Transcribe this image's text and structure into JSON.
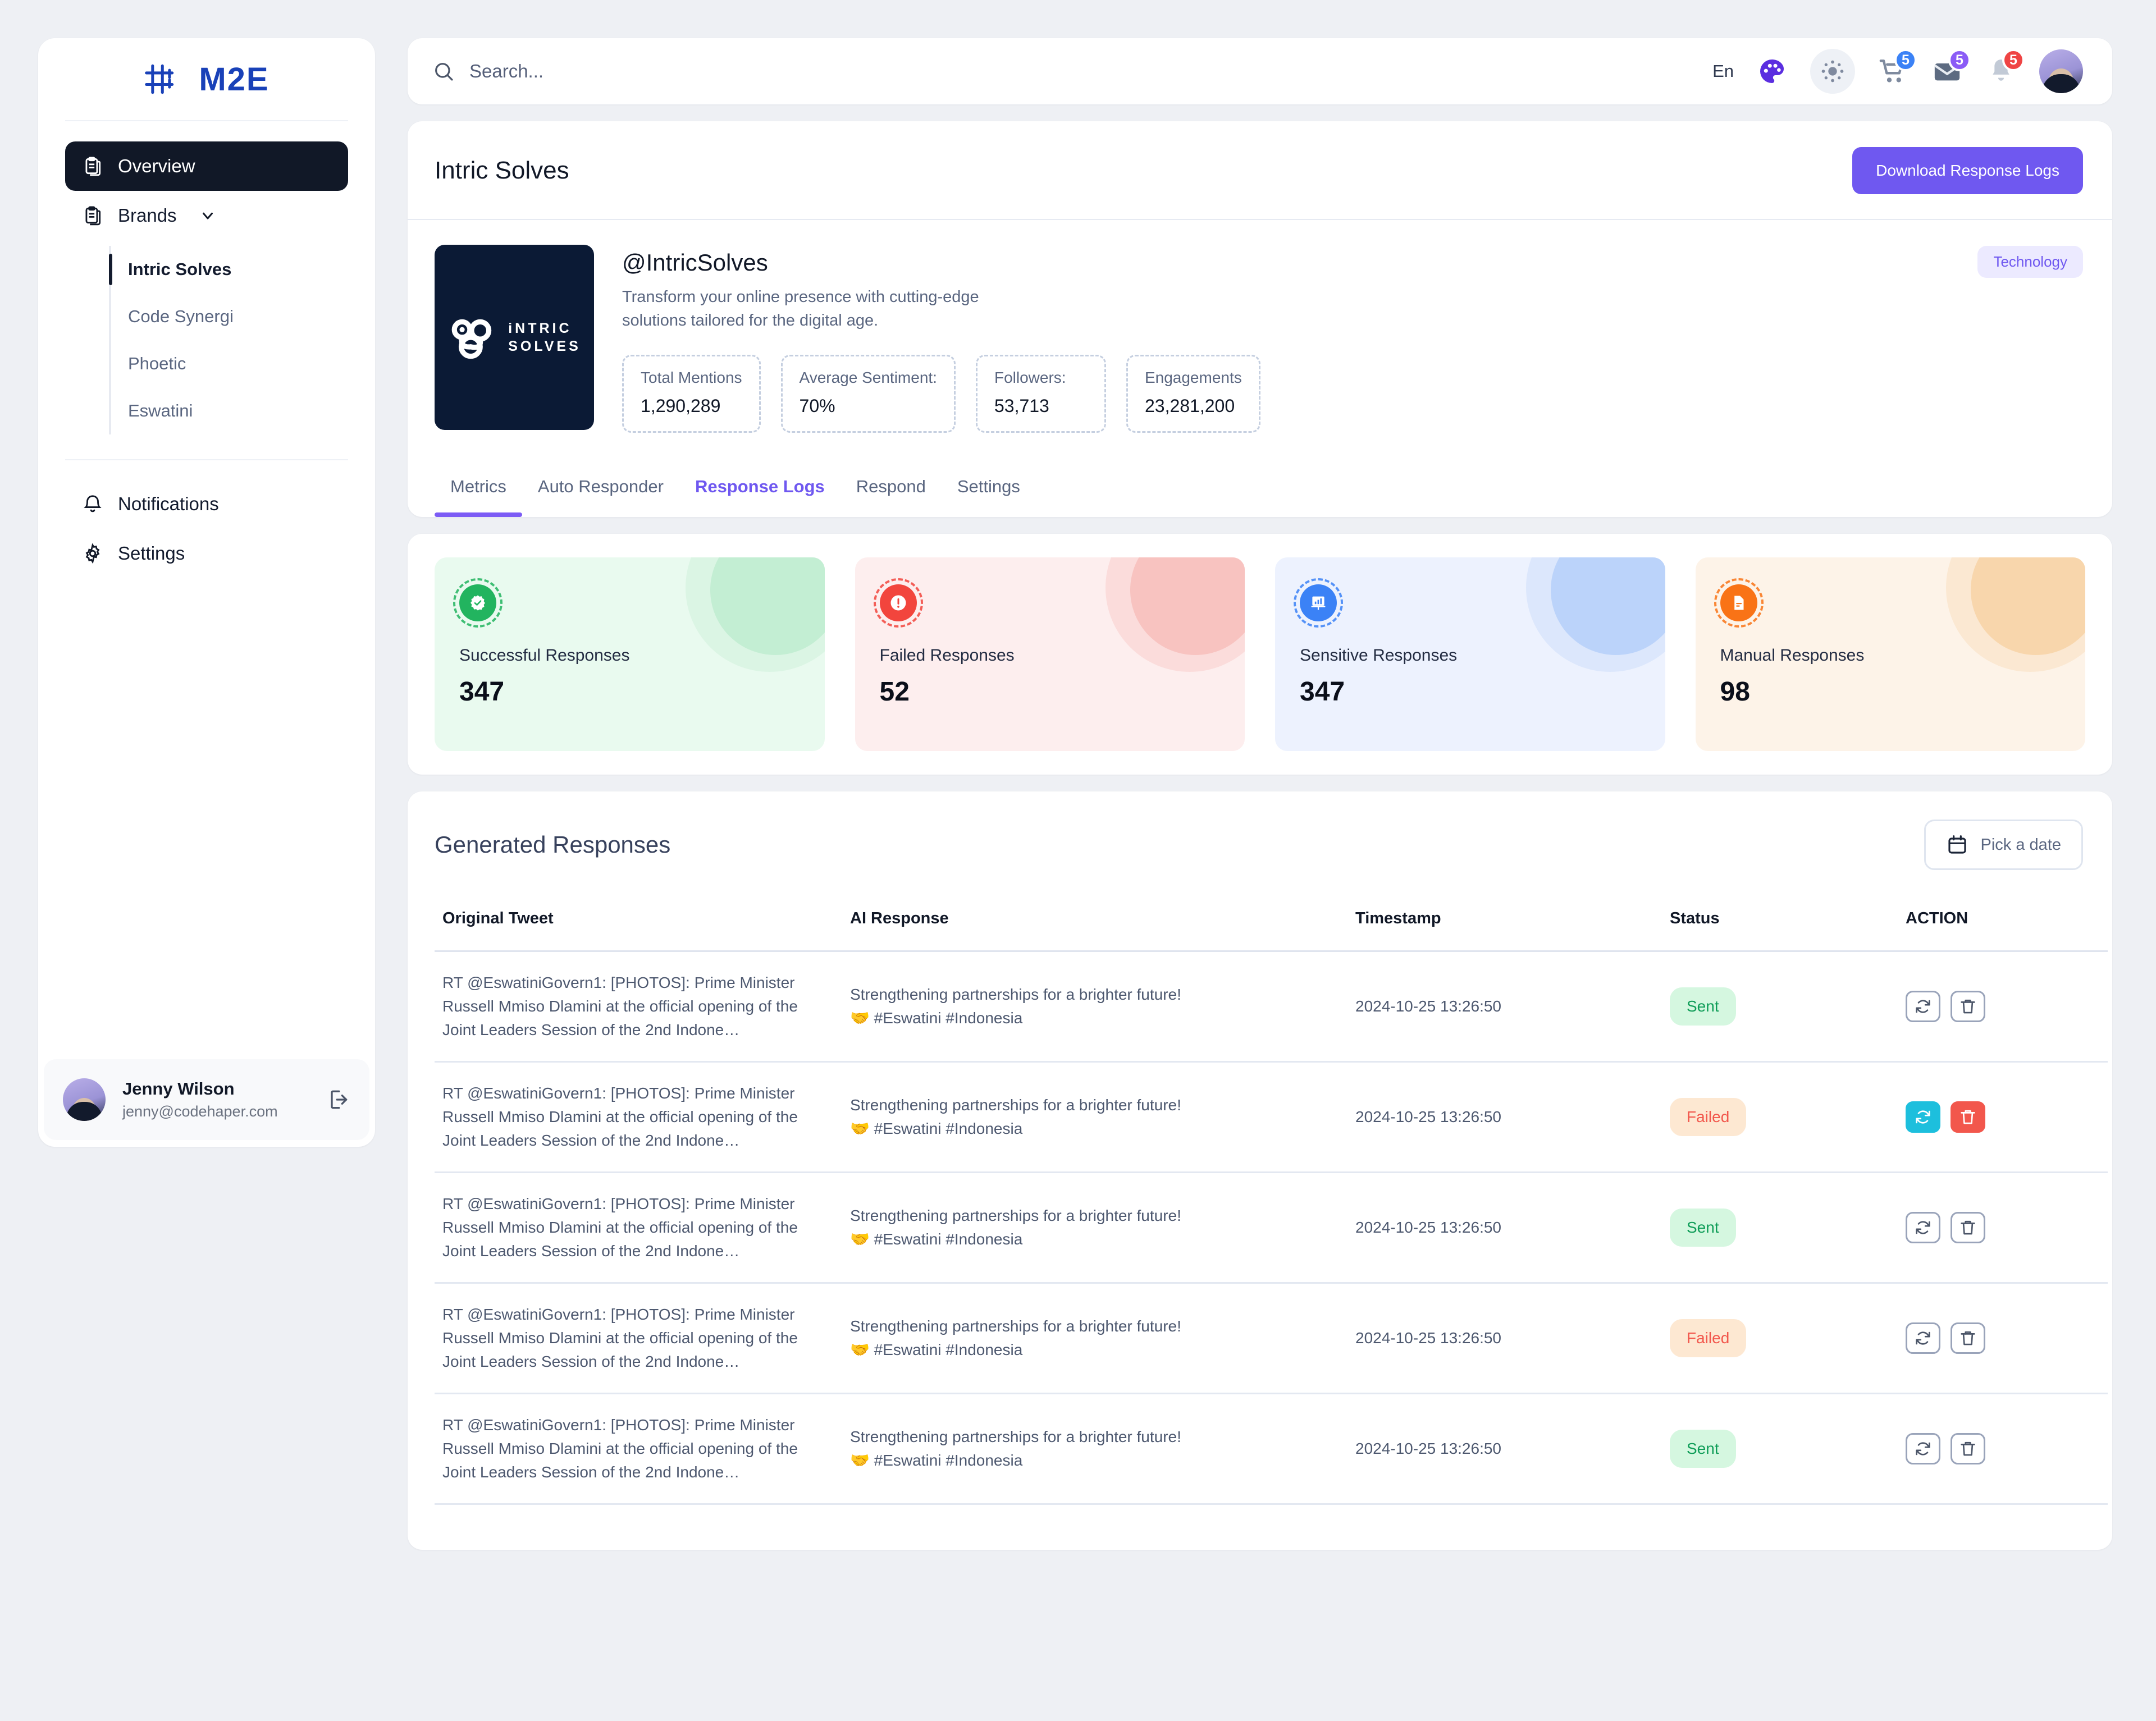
{
  "brand": {
    "logo_text": "M2E",
    "accent": "#1941b8"
  },
  "sidebar": {
    "nav": [
      {
        "label": "Overview",
        "icon": "clipboard-icon",
        "active": true
      },
      {
        "label": "Brands",
        "icon": "clipboard-icon",
        "active": false
      }
    ],
    "brands": [
      {
        "label": "Intric Solves",
        "selected": true
      },
      {
        "label": "Code Synergi",
        "selected": false
      },
      {
        "label": "Phoetic",
        "selected": false
      },
      {
        "label": "Eswatini",
        "selected": false
      }
    ],
    "lower": [
      {
        "label": "Notifications",
        "icon": "bell-icon"
      },
      {
        "label": "Settings",
        "icon": "gear-icon"
      }
    ],
    "profile": {
      "name": "Jenny Wilson",
      "email": "jenny@codehaper.com"
    }
  },
  "topbar": {
    "search_placeholder": "Search...",
    "search_value": "",
    "language": "En",
    "icons": [
      {
        "name": "palette-icon",
        "badge": null
      },
      {
        "name": "sun-icon",
        "badge": null
      },
      {
        "name": "cart-icon",
        "badge": "5",
        "badge_color": "#3b82f6"
      },
      {
        "name": "mail-icon",
        "badge": "5",
        "badge_color": "#8b5cf6"
      },
      {
        "name": "bell-icon",
        "badge": "5",
        "badge_color": "#ef4444"
      }
    ]
  },
  "brand_panel": {
    "title": "Intric Solves",
    "download_button": "Download Response Logs",
    "logo_line1": "iNTRIC",
    "logo_line2": "SOLVES",
    "handle": "@IntricSolves",
    "bio": "Transform your online presence with cutting-edge solutions tailored for the digital age.",
    "category_tag": "Technology",
    "stats": [
      {
        "label": "Total Mentions",
        "value": "1,290,289"
      },
      {
        "label": "Average Sentiment:",
        "value": "70%"
      },
      {
        "label": "Followers:",
        "value": "53,713"
      },
      {
        "label": "Engagements",
        "value": "23,281,200"
      }
    ]
  },
  "tabs": [
    {
      "label": "Metrics",
      "underlined": true,
      "current": false
    },
    {
      "label": "Auto Responder",
      "underlined": false,
      "current": false
    },
    {
      "label": "Response Logs",
      "underlined": false,
      "current": true
    },
    {
      "label": "Respond",
      "underlined": false,
      "current": false
    },
    {
      "label": "Settings",
      "underlined": false,
      "current": false
    }
  ],
  "stat_cards": [
    {
      "label": "Successful Responses",
      "value": "347",
      "icon": "check-badge-icon",
      "bg": "#e9faef",
      "blob_a": "#dbf5e4",
      "blob_b": "#c3eed3",
      "accent": "#22b45f"
    },
    {
      "label": "Failed Responses",
      "value": "52",
      "icon": "alert-circle-icon",
      "bg": "#fdeeee",
      "blob_a": "#fbdcdb",
      "blob_b": "#f8c3c0",
      "accent": "#f2453d"
    },
    {
      "label": "Sensitive Responses",
      "value": "347",
      "icon": "presentation-chart-icon",
      "bg": "#edf2fe",
      "blob_a": "#dce7fc",
      "blob_b": "#bbd3fa",
      "accent": "#3b82f6"
    },
    {
      "label": "Manual Responses",
      "value": "98",
      "icon": "document-icon",
      "bg": "#fdf3e8",
      "blob_a": "#fbe8d2",
      "blob_b": "#f8d6ac",
      "accent": "#f97316"
    }
  ],
  "table": {
    "title": "Generated Responses",
    "date_button": "Pick a date",
    "columns": [
      "Original Tweet",
      "AI Response",
      "Timestamp",
      "Status",
      "ACTION"
    ],
    "rows": [
      {
        "tweet": "RT @EswatiniGovern1: [PHOTOS]: Prime Minister Russell Mmiso Dlamini at the official opening of the Joint Leaders Session of the 2nd Indone…",
        "response_line1": "Strengthening partnerships for a brighter future!",
        "response_emoji": "🤝",
        "response_line2": "#Eswatini #Indonesia",
        "timestamp": "2024-10-25 13:26:50",
        "status": "Sent",
        "status_type": "sent",
        "actions_highlighted": false
      },
      {
        "tweet": "RT @EswatiniGovern1: [PHOTOS]: Prime Minister Russell Mmiso Dlamini at the official opening of the Joint Leaders Session of the 2nd Indone…",
        "response_line1": "Strengthening partnerships for a brighter future!",
        "response_emoji": "🤝",
        "response_line2": "#Eswatini #Indonesia",
        "timestamp": "2024-10-25 13:26:50",
        "status": "Failed",
        "status_type": "failed",
        "actions_highlighted": true
      },
      {
        "tweet": "RT @EswatiniGovern1: [PHOTOS]: Prime Minister Russell Mmiso Dlamini at the official opening of the Joint Leaders Session of the 2nd Indone…",
        "response_line1": "Strengthening partnerships for a brighter future!",
        "response_emoji": "🤝",
        "response_line2": "#Eswatini #Indonesia",
        "timestamp": "2024-10-25 13:26:50",
        "status": "Sent",
        "status_type": "sent",
        "actions_highlighted": false
      },
      {
        "tweet": "RT @EswatiniGovern1: [PHOTOS]: Prime Minister Russell Mmiso Dlamini at the official opening of the Joint Leaders Session of the 2nd Indone…",
        "response_line1": "Strengthening partnerships for a brighter future!",
        "response_emoji": "🤝",
        "response_line2": "#Eswatini #Indonesia",
        "timestamp": "2024-10-25 13:26:50",
        "status": "Failed",
        "status_type": "failed",
        "actions_highlighted": false
      },
      {
        "tweet": "RT @EswatiniGovern1: [PHOTOS]: Prime Minister Russell Mmiso Dlamini at the official opening of the Joint Leaders Session of the 2nd Indone…",
        "response_line1": "Strengthening partnerships for a brighter future!",
        "response_emoji": "🤝",
        "response_line2": "#Eswatini #Indonesia",
        "timestamp": "2024-10-25 13:26:50",
        "status": "Sent",
        "status_type": "sent",
        "actions_highlighted": false
      }
    ]
  }
}
